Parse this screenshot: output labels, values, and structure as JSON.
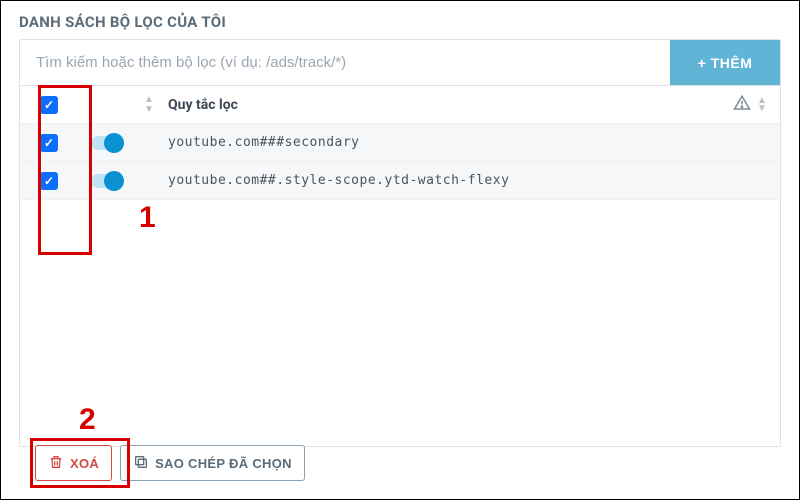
{
  "title": "DANH SÁCH BỘ LỌC CỦA TÔI",
  "search": {
    "placeholder": "Tìm kiếm hoặc thêm bộ lọc (ví dụ: /ads/track/*)",
    "value": ""
  },
  "add_button": "+ THÊM",
  "columns": {
    "rule": "Quy tắc lọc"
  },
  "rows": [
    {
      "checked": true,
      "enabled": true,
      "rule": "youtube.com###secondary"
    },
    {
      "checked": true,
      "enabled": true,
      "rule": "youtube.com##.style-scope.ytd-watch-flexy"
    }
  ],
  "footer": {
    "delete": "XOÁ",
    "copy_selected": "SAO CHÉP ĐÃ CHỌN"
  },
  "annotations": {
    "one": "1",
    "two": "2"
  },
  "colors": {
    "accent": "#62b4d6",
    "danger": "#d64a43",
    "highlight": "#d60000",
    "check": "#0d6efd"
  }
}
